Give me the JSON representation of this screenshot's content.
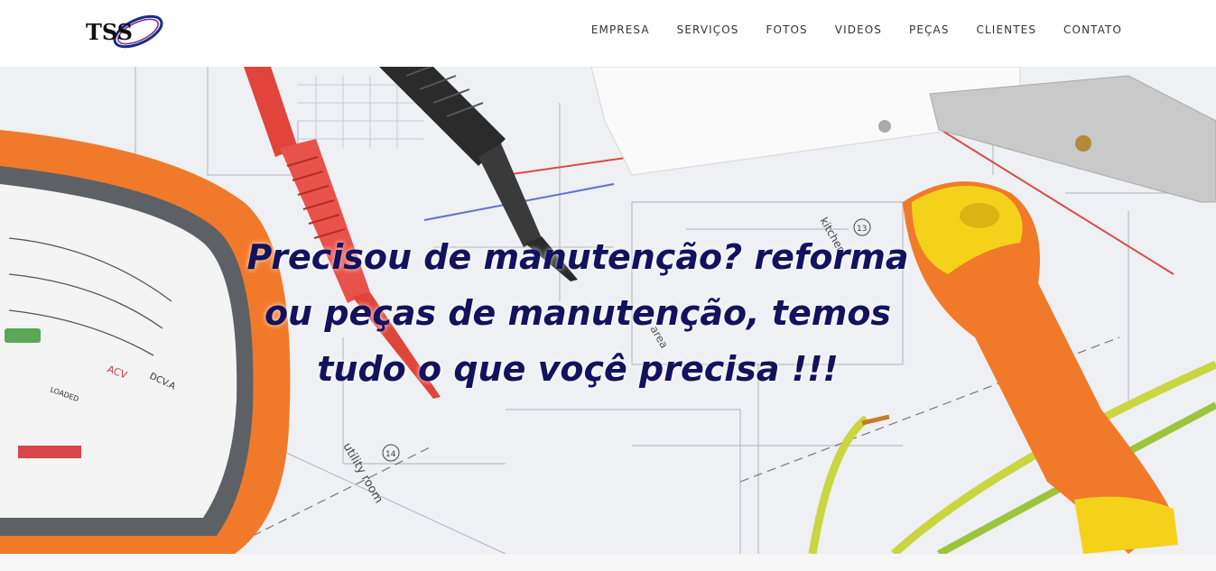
{
  "logo": {
    "text": "TSS"
  },
  "nav": {
    "items": [
      {
        "label": "EMPRESA"
      },
      {
        "label": "SERVIÇOS"
      },
      {
        "label": "FOTOS"
      },
      {
        "label": "VIDEOS"
      },
      {
        "label": "PEÇAS"
      },
      {
        "label": "CLIENTES"
      },
      {
        "label": "CONTATO"
      }
    ]
  },
  "hero": {
    "headline_lines": [
      "Precisou de manutenção? reforma",
      "ou peças de manutenção, temos",
      "tudo o que voçê precisa !!!"
    ],
    "background_labels": {
      "room": "utility room",
      "room_number": "14",
      "kitchen": "kitchen",
      "kitchen_number": "13",
      "area": "area",
      "dial_acv": "ACV",
      "dial_dcv": "DCV.A",
      "dial_loaded": "LOADED"
    }
  },
  "colors": {
    "headline": "#13125e",
    "nav_text": "#333333",
    "multimeter_orange": "#f07a2a",
    "screwdriver_yellow": "#f5d21a",
    "probe_red": "#e0443a",
    "probe_black": "#2b2b2b",
    "wire_green_yellow": "#c9d640"
  }
}
